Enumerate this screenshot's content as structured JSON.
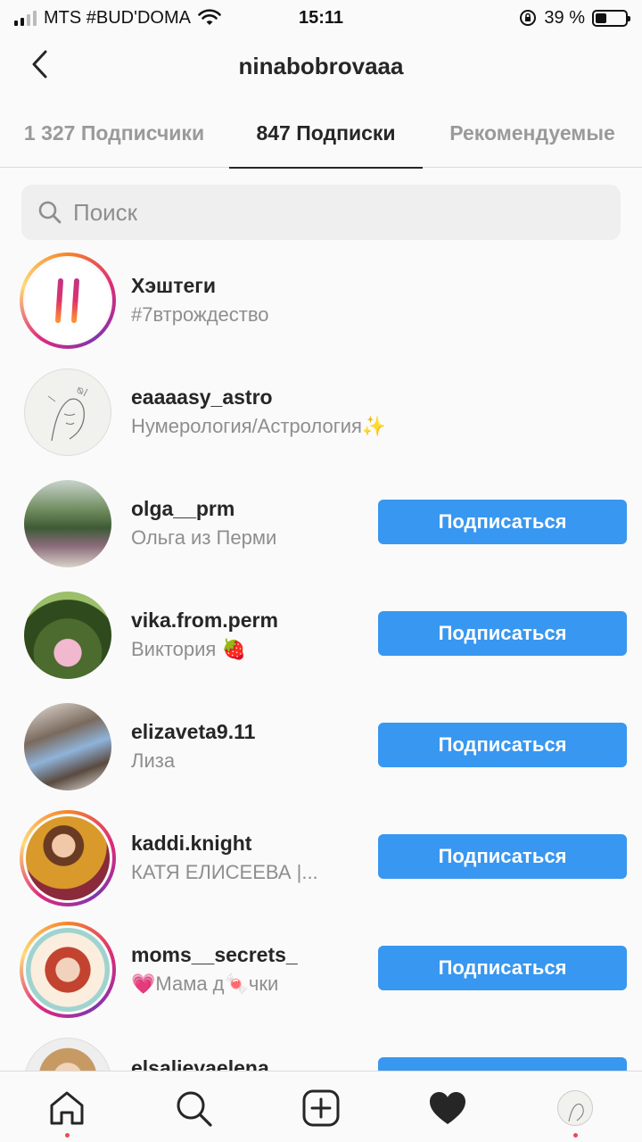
{
  "status_bar": {
    "carrier": "MTS #BUD'DOMA",
    "time": "15:11",
    "battery": "39 %",
    "battery_level": 0.39
  },
  "header": {
    "title": "ninabobrovaaa",
    "back_icon": "chevron-left-icon"
  },
  "tabs": [
    {
      "label": "1 327 Подписчики",
      "active": false
    },
    {
      "label": "847 Подписки",
      "active": true
    },
    {
      "label": "Рекомендуемые",
      "active": false
    }
  ],
  "search": {
    "placeholder": "Поиск",
    "icon": "search-icon"
  },
  "list": [
    {
      "username": "Хэштеги",
      "subtitle": "#7втрождество",
      "button": ""
    },
    {
      "username": "eaaaasy_astro",
      "subtitle": "Нумерология/Астрология✨",
      "button": ""
    },
    {
      "username": "olga__prm",
      "subtitle": "Ольга из Перми",
      "button": "Подписаться"
    },
    {
      "username": "vika.from.perm",
      "subtitle": "Виктория 🍓",
      "button": "Подписаться"
    },
    {
      "username": "elizaveta9.11",
      "subtitle": "Лиза",
      "button": "Подписаться"
    },
    {
      "username": "kaddi.knight",
      "subtitle": "КАТЯ ЕЛИСЕЕВА |...",
      "button": "Подписаться"
    },
    {
      "username": "moms__secrets_",
      "subtitle": "💗Мама д🍬чки",
      "button": "Подписаться"
    },
    {
      "username": "elsalievaelena",
      "subtitle": "",
      "button": ""
    }
  ],
  "bottom_nav": [
    {
      "icon": "home-icon",
      "notification": true
    },
    {
      "icon": "search-icon",
      "notification": false
    },
    {
      "icon": "add-post-icon",
      "notification": false
    },
    {
      "icon": "heart-icon",
      "notification": false
    },
    {
      "icon": "profile-avatar",
      "notification": true
    }
  ],
  "colors": {
    "accent": "#3897f0",
    "text": "#262626",
    "secondary_text": "#8e8e8e",
    "background": "#fafafa",
    "notification_dot": "#ed4956"
  }
}
